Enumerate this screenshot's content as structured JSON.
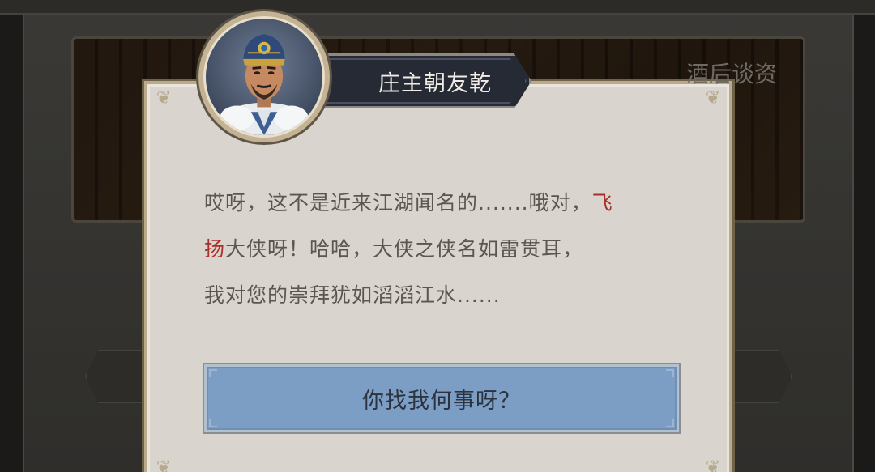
{
  "scene": {
    "title": "酒后谈资"
  },
  "speaker": {
    "name": "庄主朝友乾",
    "portrait_icon": "character-portrait-icon"
  },
  "dialog": {
    "line1": "哎呀，这不是近来江湖闻名的.......哦对，",
    "hero_name_part1": "飞",
    "hero_name_part2": "扬",
    "line2_rest": "大侠呀！哈哈，大侠之侠名如雷贯耳，",
    "line3": "我对您的崇拜犹如滔滔江水......"
  },
  "reply": {
    "label": "你找我何事呀？"
  },
  "colors": {
    "highlight": "#a8302a",
    "dialog_bg": "#d9d4ce",
    "reply_bg": "#7d9ec4",
    "name_plate_bg": "#262a35"
  }
}
